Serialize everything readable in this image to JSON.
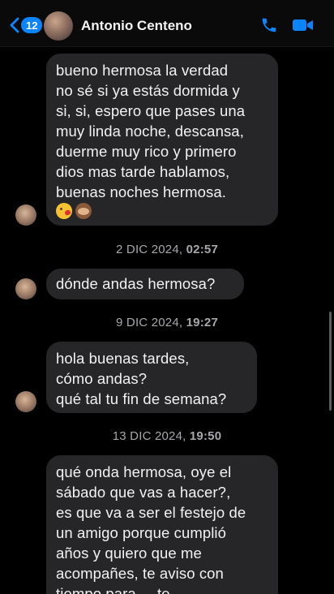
{
  "header": {
    "unread_count": "12",
    "contact_name": "Antonio Centeno",
    "icons": {
      "back": "chevron-left-icon",
      "call": "phone-icon",
      "video": "video-camera-icon"
    }
  },
  "messages": [
    {
      "lines": [
        "bueno hermosa la verdad",
        "no sé si ya estás dormida y",
        "si, si, espero que pases una",
        "muy linda noche, descansa,",
        "duerme muy rico y primero",
        "dios mas tarde hablamos,",
        "buenas noches hermosa."
      ],
      "emojis": [
        "kissing-face-heart",
        "see-no-evil-monkey"
      ]
    },
    {
      "timestamp_date": "2 DIC 2024,",
      "timestamp_time": "02:57"
    },
    {
      "lines": [
        "dónde andas hermosa?"
      ]
    },
    {
      "timestamp_date": "9 DIC 2024,",
      "timestamp_time": "19:27"
    },
    {
      "lines": [
        "hola buenas tardes,",
        "cómo andas?",
        "qué tal tu fin de semana?"
      ]
    },
    {
      "timestamp_date": "13 DIC 2024,",
      "timestamp_time": "19:50"
    },
    {
      "lines": [
        "qué onda hermosa, oye el",
        "sábado que vas a hacer?,",
        "es que va a ser el festejo de",
        "un amigo porque cumplió",
        "años y quiero que me",
        "acompañes, te aviso con",
        "tiempo para ... te"
      ]
    }
  ],
  "colors": {
    "accent": "#0a84ff",
    "bubble": "#262629",
    "background": "#000000",
    "timestamp": "#a7a7ac"
  }
}
